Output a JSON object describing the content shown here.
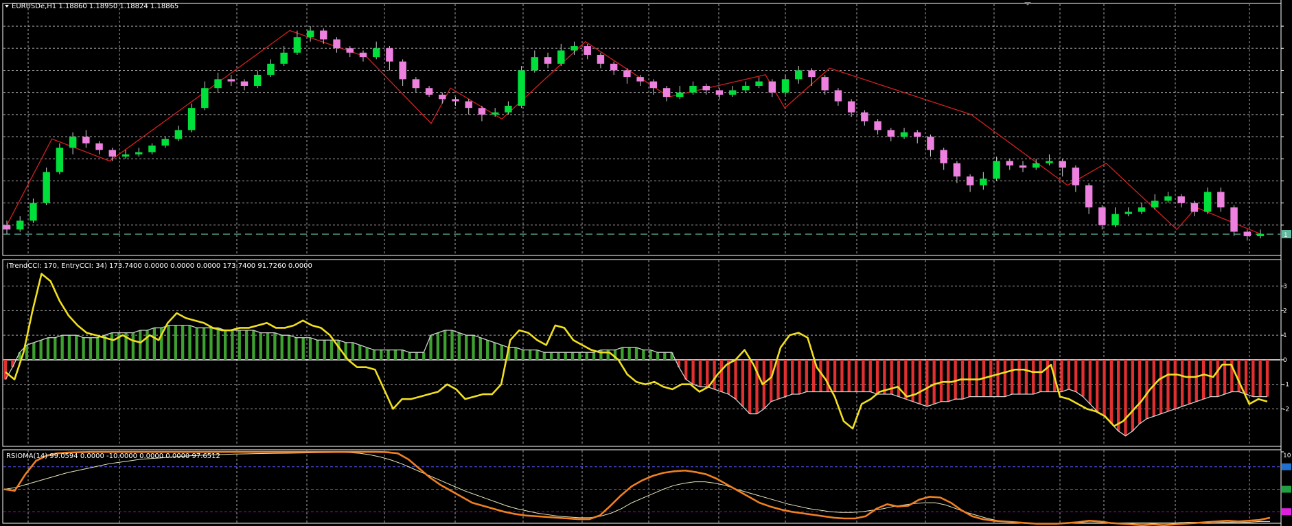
{
  "main": {
    "title": "EURUSDe,H1  1.18860 1.18950 1.18824 1.18865",
    "price_line_label": "1",
    "candles": [
      [
        1.0,
        0.8,
        1.2,
        0.6
      ],
      [
        0.8,
        1.2,
        1.4,
        0.7
      ],
      [
        1.2,
        2.0,
        2.2,
        1.1
      ],
      [
        2.0,
        3.4,
        3.6,
        1.9
      ],
      [
        3.4,
        4.5,
        4.7,
        3.3
      ],
      [
        4.5,
        5.0,
        5.2,
        4.2
      ],
      [
        5.0,
        4.7,
        5.3,
        4.5
      ],
      [
        4.7,
        4.4,
        4.8,
        4.2
      ],
      [
        4.4,
        4.1,
        4.5,
        3.9
      ],
      [
        4.1,
        4.2,
        4.4,
        4.0
      ],
      [
        4.2,
        4.3,
        4.5,
        4.1
      ],
      [
        4.3,
        4.6,
        4.7,
        4.2
      ],
      [
        4.6,
        4.9,
        5.0,
        4.5
      ],
      [
        4.9,
        5.3,
        5.5,
        4.8
      ],
      [
        5.3,
        6.3,
        6.5,
        5.2
      ],
      [
        6.3,
        7.2,
        7.5,
        6.2
      ],
      [
        7.2,
        7.6,
        7.9,
        7.0
      ],
      [
        7.6,
        7.5,
        7.8,
        7.3
      ],
      [
        7.5,
        7.3,
        7.6,
        7.1
      ],
      [
        7.3,
        7.8,
        8.0,
        7.2
      ],
      [
        7.8,
        8.3,
        8.5,
        7.7
      ],
      [
        8.3,
        8.8,
        9.1,
        8.2
      ],
      [
        8.8,
        9.5,
        9.8,
        8.7
      ],
      [
        9.5,
        9.8,
        10.0,
        9.3
      ],
      [
        9.8,
        9.4,
        9.9,
        9.2
      ],
      [
        9.4,
        9.0,
        9.5,
        8.8
      ],
      [
        9.0,
        8.8,
        9.1,
        8.6
      ],
      [
        8.8,
        8.6,
        8.9,
        8.4
      ],
      [
        8.6,
        9.0,
        9.3,
        8.5
      ],
      [
        9.0,
        8.4,
        9.1,
        8.0
      ],
      [
        8.4,
        7.6,
        8.5,
        7.3
      ],
      [
        7.6,
        7.2,
        7.7,
        7.0
      ],
      [
        7.2,
        6.9,
        7.3,
        6.8
      ],
      [
        6.9,
        6.7,
        7.0,
        6.5
      ],
      [
        6.7,
        6.6,
        6.8,
        6.4
      ],
      [
        6.6,
        6.3,
        6.7,
        6.0
      ],
      [
        6.3,
        6.0,
        6.4,
        5.7
      ],
      [
        6.0,
        6.1,
        6.3,
        5.9
      ],
      [
        6.1,
        6.4,
        6.6,
        6.0
      ],
      [
        6.4,
        8.0,
        8.2,
        6.3
      ],
      [
        8.0,
        8.6,
        8.9,
        7.9
      ],
      [
        8.6,
        8.3,
        8.8,
        8.1
      ],
      [
        8.3,
        8.9,
        9.2,
        8.2
      ],
      [
        8.9,
        9.1,
        9.3,
        8.7
      ],
      [
        9.1,
        8.7,
        9.2,
        8.5
      ],
      [
        8.7,
        8.3,
        8.8,
        8.1
      ],
      [
        8.3,
        8.0,
        8.4,
        7.8
      ],
      [
        8.0,
        7.7,
        8.1,
        7.4
      ],
      [
        7.7,
        7.5,
        7.8,
        7.3
      ],
      [
        7.5,
        7.2,
        7.6,
        6.9
      ],
      [
        7.2,
        6.8,
        7.3,
        6.6
      ],
      [
        6.8,
        7.0,
        7.3,
        6.7
      ],
      [
        7.0,
        7.3,
        7.5,
        6.9
      ],
      [
        7.3,
        7.1,
        7.4,
        6.9
      ],
      [
        7.1,
        6.9,
        7.2,
        6.7
      ],
      [
        6.9,
        7.1,
        7.3,
        6.8
      ],
      [
        7.1,
        7.3,
        7.5,
        7.0
      ],
      [
        7.3,
        7.5,
        7.7,
        7.2
      ],
      [
        7.5,
        7.0,
        7.6,
        6.8
      ],
      [
        7.0,
        7.6,
        7.8,
        6.9
      ],
      [
        7.6,
        8.0,
        8.2,
        7.4
      ],
      [
        8.0,
        7.7,
        8.1,
        7.3
      ],
      [
        7.7,
        7.1,
        7.8,
        6.9
      ],
      [
        7.1,
        6.6,
        7.2,
        6.4
      ],
      [
        6.6,
        6.1,
        6.7,
        5.9
      ],
      [
        6.1,
        5.7,
        6.2,
        5.5
      ],
      [
        5.7,
        5.3,
        5.8,
        5.1
      ],
      [
        5.3,
        5.0,
        5.4,
        4.8
      ],
      [
        5.0,
        5.2,
        5.4,
        4.9
      ],
      [
        5.2,
        5.0,
        5.3,
        4.7
      ],
      [
        5.0,
        4.4,
        5.1,
        4.1
      ],
      [
        4.4,
        3.8,
        4.5,
        3.5
      ],
      [
        3.8,
        3.2,
        3.9,
        2.9
      ],
      [
        3.2,
        2.8,
        3.3,
        2.5
      ],
      [
        2.8,
        3.1,
        3.4,
        2.6
      ],
      [
        3.1,
        3.9,
        4.1,
        3.0
      ],
      [
        3.9,
        3.7,
        4.0,
        3.5
      ],
      [
        3.7,
        3.6,
        3.9,
        3.4
      ],
      [
        3.6,
        3.8,
        4.0,
        3.5
      ],
      [
        3.8,
        3.9,
        4.2,
        3.7
      ],
      [
        3.9,
        3.6,
        4.0,
        3.2
      ],
      [
        3.6,
        2.8,
        3.7,
        2.5
      ],
      [
        2.8,
        1.8,
        2.9,
        1.5
      ],
      [
        1.8,
        1.0,
        1.9,
        0.8
      ],
      [
        1.0,
        1.5,
        1.8,
        0.9
      ],
      [
        1.5,
        1.6,
        1.8,
        1.4
      ],
      [
        1.6,
        1.8,
        2.0,
        1.5
      ],
      [
        1.8,
        2.1,
        2.4,
        1.7
      ],
      [
        2.1,
        2.3,
        2.5,
        2.0
      ],
      [
        2.3,
        2.0,
        2.4,
        1.8
      ],
      [
        2.0,
        1.6,
        2.1,
        1.4
      ],
      [
        1.6,
        2.5,
        2.7,
        1.5
      ],
      [
        2.5,
        1.8,
        2.7,
        1.6
      ],
      [
        1.8,
        0.7,
        1.9,
        0.5
      ],
      [
        0.7,
        0.5,
        0.8,
        0.3
      ],
      [
        0.5,
        0.6,
        0.8,
        0.4
      ]
    ],
    "zigzag": [
      [
        0,
        1.0
      ],
      [
        7,
        4.9
      ],
      [
        16,
        3.9
      ],
      [
        44,
        9.8
      ],
      [
        56,
        8.6
      ],
      [
        66,
        5.6
      ],
      [
        69,
        7.2
      ],
      [
        77,
        5.8
      ],
      [
        90,
        9.3
      ],
      [
        103,
        6.8
      ],
      [
        118,
        7.8
      ],
      [
        121,
        6.3
      ],
      [
        128,
        8.1
      ],
      [
        150,
        6.0
      ],
      [
        165,
        2.8
      ],
      [
        171,
        3.8
      ],
      [
        182,
        0.8
      ],
      [
        185,
        1.8
      ],
      [
        190,
        1.2
      ],
      [
        195,
        0.6
      ]
    ],
    "colors": {
      "bull": "#00e03a",
      "bear": "#ee80e0",
      "zigzag": "#d42020",
      "grid": "#a9a9a9",
      "hline": "#5fb8a0"
    }
  },
  "cci": {
    "label": "(TrendCCI: 170, EntryCCI: 34)  173.7400 0.0000 0.0000 0.0000 173.7400 91.7260 0.0000",
    "axis_ticks": [
      "3",
      "2",
      "1",
      "0",
      "-1",
      "-2"
    ],
    "trend": [
      -0.8,
      -0.3,
      0.3,
      0.6,
      0.7,
      0.8,
      0.9,
      0.9,
      1.0,
      1.0,
      1.0,
      0.9,
      0.9,
      0.9,
      1.0,
      1.1,
      1.1,
      1.1,
      1.1,
      1.2,
      1.2,
      1.3,
      1.3,
      1.4,
      1.4,
      1.4,
      1.4,
      1.3,
      1.3,
      1.3,
      1.3,
      1.2,
      1.2,
      1.2,
      1.2,
      1.2,
      1.1,
      1.1,
      1.1,
      1.0,
      1.0,
      0.9,
      0.9,
      0.9,
      0.8,
      0.8,
      0.8,
      0.8,
      0.7,
      0.7,
      0.6,
      0.5,
      0.4,
      0.4,
      0.4,
      0.4,
      0.4,
      0.3,
      0.3,
      0.3,
      1.0,
      1.1,
      1.2,
      1.2,
      1.1,
      1.0,
      1.0,
      0.9,
      0.8,
      0.7,
      0.6,
      0.5,
      0.5,
      0.4,
      0.4,
      0.4,
      0.3,
      0.3,
      0.3,
      0.3,
      0.3,
      0.3,
      0.3,
      0.3,
      0.4,
      0.4,
      0.4,
      0.5,
      0.5,
      0.5,
      0.4,
      0.4,
      0.3,
      0.3,
      0.3,
      -0.3,
      -0.8,
      -1.0,
      -1.1,
      -1.1,
      -1.2,
      -1.3,
      -1.4,
      -1.6,
      -1.9,
      -2.2,
      -2.2,
      -2.0,
      -1.7,
      -1.6,
      -1.5,
      -1.4,
      -1.4,
      -1.3,
      -1.3,
      -1.3,
      -1.3,
      -1.3,
      -1.3,
      -1.3,
      -1.3,
      -1.3,
      -1.3,
      -1.4,
      -1.4,
      -1.4,
      -1.5,
      -1.6,
      -1.7,
      -1.8,
      -1.9,
      -1.8,
      -1.7,
      -1.7,
      -1.6,
      -1.6,
      -1.5,
      -1.5,
      -1.5,
      -1.5,
      -1.5,
      -1.5,
      -1.4,
      -1.4,
      -1.4,
      -1.4,
      -1.3,
      -1.3,
      -1.3,
      -1.3,
      -1.2,
      -1.3,
      -1.5,
      -1.8,
      -2.1,
      -2.3,
      -2.6,
      -2.9,
      -3.1,
      -2.9,
      -2.6,
      -2.4,
      -2.3,
      -2.2,
      -2.1,
      -2.0,
      -1.9,
      -1.8,
      -1.7,
      -1.6,
      -1.5,
      -1.5,
      -1.4,
      -1.3,
      -1.3,
      -1.4,
      -1.5,
      -1.5,
      -1.5
    ],
    "entry": [
      -0.5,
      -0.8,
      0.3,
      2.0,
      3.5,
      3.2,
      2.4,
      1.8,
      1.4,
      1.1,
      1.0,
      0.9,
      0.8,
      1.0,
      0.8,
      0.7,
      1.0,
      0.8,
      1.5,
      1.9,
      1.7,
      1.6,
      1.5,
      1.3,
      1.2,
      1.2,
      1.3,
      1.3,
      1.4,
      1.5,
      1.3,
      1.3,
      1.4,
      1.6,
      1.4,
      1.3,
      1.0,
      0.5,
      0.0,
      -0.3,
      -0.3,
      -0.4,
      -1.2,
      -2.0,
      -1.6,
      -1.6,
      -1.5,
      -1.4,
      -1.3,
      -1.0,
      -1.2,
      -1.6,
      -1.5,
      -1.4,
      -1.4,
      -1.0,
      0.8,
      1.2,
      1.1,
      0.8,
      0.6,
      1.4,
      1.3,
      0.8,
      0.6,
      0.4,
      0.3,
      0.3,
      0.0,
      -0.6,
      -0.9,
      -1.0,
      -0.9,
      -1.1,
      -1.2,
      -1.0,
      -1.0,
      -1.3,
      -1.1,
      -0.6,
      -0.2,
      0.0,
      0.4,
      -0.2,
      -1.0,
      -0.7,
      0.5,
      1.0,
      1.1,
      0.9,
      -0.3,
      -0.8,
      -1.5,
      -2.5,
      -2.8,
      -1.8,
      -1.6,
      -1.3,
      -1.2,
      -1.1,
      -1.5,
      -1.4,
      -1.2,
      -1.0,
      -0.9,
      -0.9,
      -0.8,
      -0.8,
      -0.8,
      -0.7,
      -0.6,
      -0.5,
      -0.4,
      -0.4,
      -0.5,
      -0.5,
      -0.2,
      -1.5,
      -1.6,
      -1.8,
      -2.0,
      -2.1,
      -2.3,
      -2.7,
      -2.5,
      -2.1,
      -1.7,
      -1.2,
      -0.8,
      -0.6,
      -0.6,
      -0.7,
      -0.7,
      -0.6,
      -0.7,
      -0.2,
      -0.2,
      -1.0,
      -1.8,
      -1.6,
      -1.7
    ],
    "colors": {
      "entry": "#f0e020",
      "trend": "#d0d0d0",
      "pos_hist": "#3ea030",
      "neg_hist": "#e03030"
    }
  },
  "rsioma": {
    "label": "RSIOMA(14) 99.0594 0.0000 -10.0000 0.0000 0.0000 97.6512",
    "axis_ticks": [
      "10",
      ""
    ],
    "fast": [
      50,
      48,
      70,
      88,
      95,
      98,
      99,
      99.5,
      99.8,
      99.9,
      99.9,
      99.9,
      99.9,
      99.9,
      99.9,
      99.9,
      99.9,
      99.9,
      99.9,
      99.9,
      99.9,
      99.9,
      99.9,
      99.9,
      99.9,
      99.9,
      99.9,
      99.9,
      99.9,
      99.9,
      99.9,
      99.9,
      99.9,
      99.9,
      99.9,
      99.9,
      99.5,
      98,
      90,
      78,
      66,
      56,
      48,
      40,
      32,
      28,
      24,
      20,
      17,
      15,
      14,
      13,
      12,
      11,
      10,
      10,
      15,
      28,
      42,
      54,
      62,
      68,
      72,
      74,
      75,
      73,
      70,
      64,
      56,
      48,
      40,
      32,
      27,
      23,
      20,
      18,
      16,
      14,
      12,
      11,
      11,
      14,
      24,
      30,
      27,
      28,
      36,
      40,
      39,
      32,
      22,
      14,
      10,
      8,
      7,
      6,
      5,
      4,
      4,
      4,
      5,
      6,
      8,
      7,
      5,
      4,
      3,
      2,
      3,
      2,
      3,
      4,
      5,
      6,
      7,
      8,
      7,
      8,
      9,
      12
    ],
    "slow": [
      50,
      52,
      56,
      60,
      64,
      68,
      72,
      75,
      78,
      81,
      84,
      86,
      88,
      90,
      91,
      92,
      93,
      94,
      95,
      95.5,
      96,
      96.5,
      97,
      97.3,
      97.6,
      97.8,
      98,
      98.2,
      98.4,
      98.6,
      98.8,
      99,
      99.2,
      99,
      98,
      96,
      93,
      89,
      84,
      78,
      72,
      66,
      60,
      54,
      48,
      43,
      38,
      33,
      28,
      24,
      21,
      18,
      16,
      14,
      13,
      12,
      12,
      14,
      18,
      24,
      32,
      38,
      44,
      50,
      55,
      58,
      60,
      60,
      58,
      55,
      50,
      46,
      42,
      38,
      34,
      30,
      27,
      24,
      22,
      20,
      19,
      19,
      20,
      22,
      24,
      27,
      29,
      31,
      32,
      32,
      29,
      24,
      19,
      15,
      11,
      8,
      6,
      5,
      4,
      4,
      4,
      4,
      5,
      5,
      5,
      5,
      5,
      5,
      5,
      5,
      5,
      5,
      5,
      6,
      6,
      6,
      6,
      6,
      6,
      6,
      7,
      7
    ],
    "levels": [
      80,
      50,
      20
    ],
    "colors": {
      "fast": "#f08020",
      "slow": "#e8e8c0",
      "level": "#5555ff",
      "mid": "#6060c0"
    }
  }
}
